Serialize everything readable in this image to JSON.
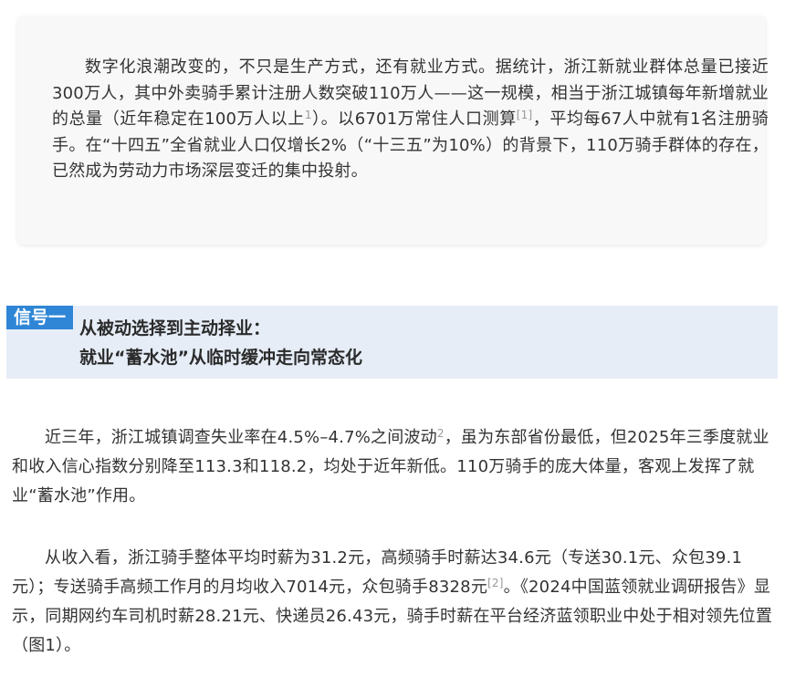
{
  "intro": {
    "p_a": "数字化浪潮改变的，不只是生产方式，还有就业方式。据统计，浙江新就业群体总量已接近300万人，其中外卖骑手累计注册人数突破110万人——这一规模，相当于浙江城镇每年新增就业的总量（近年稳定在100万人以上",
    "ref_a": "1",
    "p_b": "）。以6701万常住人口测算",
    "ref_b": "[1]",
    "p_c": "，平均每67人中就有1名注册骑手。在“十四五”全省就业人口仅增长2%（“十三五”为10%）的背景下，110万骑手群体的存在，已然成为劳动力市场深层变迁的集中投射。"
  },
  "section": {
    "tag": "信号一",
    "title_line1": "从被动选择到主动择业：",
    "title_line2": "就业“蓄水池”从临时缓冲走向常态化"
  },
  "para1": {
    "a": "近三年，浙江城镇调查失业率在4.5%–4.7%之间波动",
    "ref": "2",
    "b": "，虽为东部省份最低，但2025年三季度就业和收入信心指数分别降至113.3和118.2，均处于近年新低。110万骑手的庞大体量，客观上发挥了就业“蓄水池”作用。"
  },
  "para2": {
    "a": "从收入看，浙江骑手整体平均时薪为31.2元，高频骑手时薪达34.6元（专送30.1元、众包39.1元）；专送骑手高频工作月的月均收入7014元，众包骑手8328元",
    "ref": "[2]",
    "b": "。《2024中国蓝领就业调研报告》显示，同期网约车司机时薪28.21元、快递员26.43元，骑手时薪在平台经济蓝领职业中处于相对领先位置（图1）。"
  }
}
